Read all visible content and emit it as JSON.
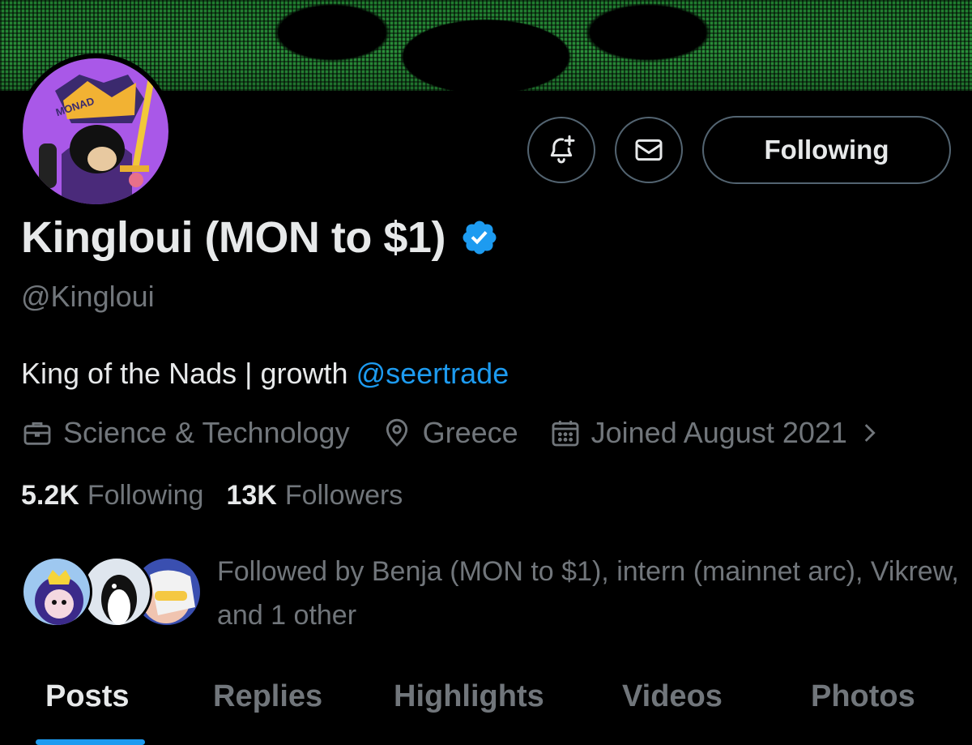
{
  "profile": {
    "display_name": "Kingloui (MON to $1)",
    "handle": "@Kingloui",
    "bio_text": "King of the Nads | growth ",
    "bio_mention": "@seertrade",
    "category": "Science & Technology",
    "location": "Greece",
    "joined": "Joined August 2021",
    "avatar_badge_text": "MONAD"
  },
  "actions": {
    "follow_label": "Following"
  },
  "stats": {
    "following_count": "5.2K",
    "following_label": "Following",
    "followers_count": "13K",
    "followers_label": "Followers"
  },
  "followed_by": {
    "text": "Followed by Benja (MON to $1), intern (mainnet arc), Vikrew, and 1 other"
  },
  "tabs": [
    {
      "label": "Posts"
    },
    {
      "label": "Replies"
    },
    {
      "label": "Highlights"
    },
    {
      "label": "Videos"
    },
    {
      "label": "Photos"
    }
  ],
  "colors": {
    "accent": "#1d9bf0",
    "secondary_text": "#71767b",
    "primary_text": "#e7e9ea",
    "border": "#536471",
    "background": "#000000"
  },
  "icons": {
    "notify": "bell-plus-icon",
    "message": "envelope-icon",
    "verified": "verified-badge-icon",
    "category": "briefcase-icon",
    "location": "location-pin-icon",
    "joined": "calendar-icon",
    "chevron": "chevron-right-icon"
  }
}
